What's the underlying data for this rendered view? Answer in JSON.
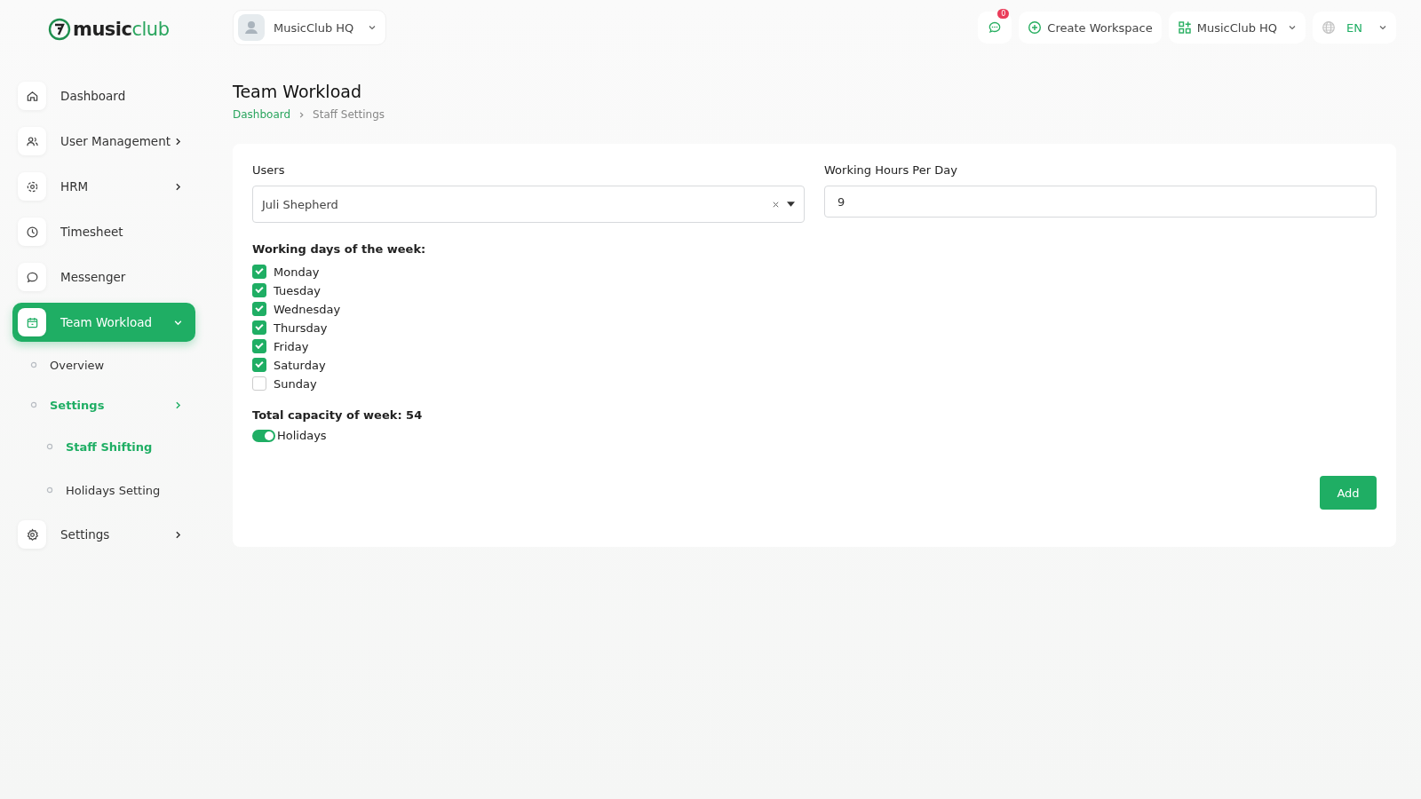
{
  "logo": {
    "strong": "music",
    "light": "club"
  },
  "workspace_switcher": {
    "label": "MusicClub HQ"
  },
  "topbar": {
    "notifications": "0",
    "create": "Create Workspace",
    "workspace": "MusicClub HQ",
    "language": "EN"
  },
  "sidebar": {
    "items": [
      {
        "label": "Dashboard",
        "selected": false,
        "expanded": false,
        "has_arrow": false
      },
      {
        "label": "User Management",
        "selected": false,
        "expanded": false,
        "has_arrow": true
      },
      {
        "label": "HRM",
        "selected": false,
        "expanded": false,
        "has_arrow": true
      },
      {
        "label": "Timesheet",
        "selected": false,
        "expanded": false,
        "has_arrow": false
      },
      {
        "label": "Messenger",
        "selected": false,
        "expanded": false,
        "has_arrow": false
      },
      {
        "label": "Team Workload",
        "selected": true,
        "expanded": true,
        "has_arrow": true,
        "children": [
          {
            "label": "Overview",
            "selected": false,
            "has_arrow": false
          },
          {
            "label": "Settings",
            "selected": true,
            "has_arrow": true,
            "children": [
              {
                "label": "Staff Shifting",
                "selected": true
              },
              {
                "label": "Holidays Setting",
                "selected": false
              }
            ]
          }
        ]
      },
      {
        "label": "Settings",
        "selected": false,
        "expanded": false,
        "has_arrow": true
      }
    ]
  },
  "page": {
    "title": "Team Workload",
    "breadcrumb": [
      {
        "label": "Dashboard",
        "link": true
      },
      {
        "label": "Staff Settings",
        "link": false
      }
    ]
  },
  "form": {
    "users_label": "Users",
    "users_value": "Juli Shepherd",
    "hours_label": "Working Hours Per Day",
    "hours_value": "9",
    "days_label": "Working days of the week:",
    "days": [
      {
        "label": "Monday",
        "checked": true
      },
      {
        "label": "Tuesday",
        "checked": true
      },
      {
        "label": "Wednesday",
        "checked": true
      },
      {
        "label": "Thursday",
        "checked": true
      },
      {
        "label": "Friday",
        "checked": true
      },
      {
        "label": "Saturday",
        "checked": true
      },
      {
        "label": "Sunday",
        "checked": false
      }
    ],
    "capacity": "Total capacity of week: 54",
    "holidays": {
      "label": "Holidays",
      "on": true
    },
    "submit": "Add"
  }
}
